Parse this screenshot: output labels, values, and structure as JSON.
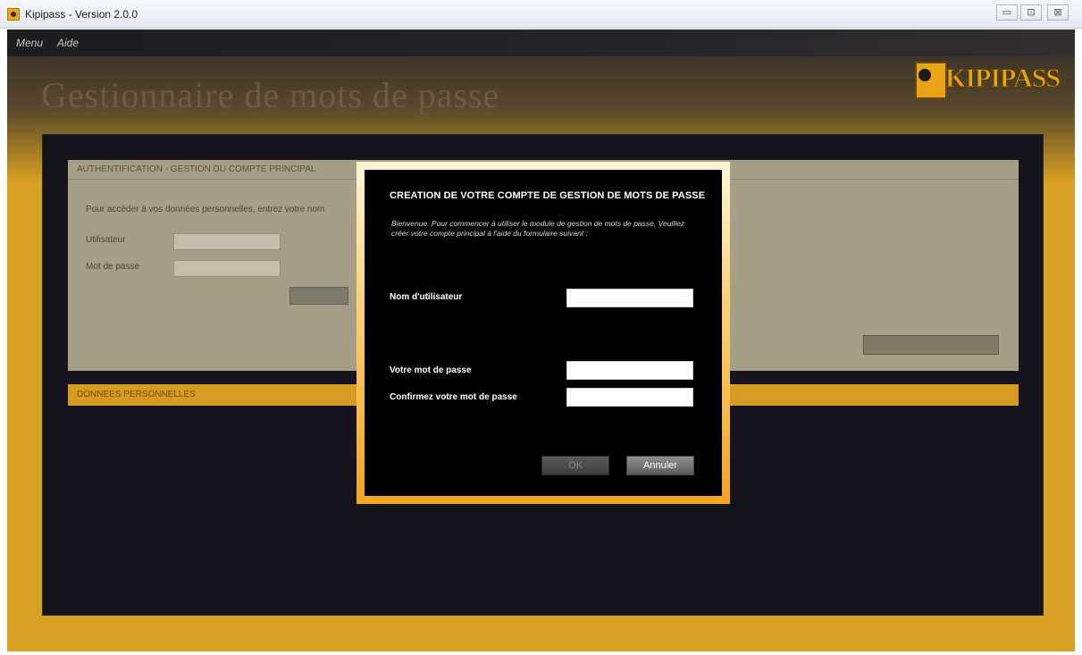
{
  "window": {
    "title": "Kipipass - Version 2.0.0",
    "controls": {
      "minimize": "▭",
      "maximize": "⊡",
      "close": "⊠"
    }
  },
  "menubar": {
    "items": [
      "Menu",
      "Aide"
    ]
  },
  "header": {
    "title": "Gestionnaire de mots de passe",
    "logo_text": "KIPIPASS"
  },
  "auth_section": {
    "header": "AUTHENTIFICATION - GESTION DU COMPTE PRINCIPAL",
    "intro": "Pour accéder à vos données personnelles, entrez votre nom",
    "username_label": "Utilisateur",
    "password_label": "Mot de passe",
    "login_button": "",
    "create_button": ""
  },
  "data_section": {
    "header": "DONNEES PERSONNELLES"
  },
  "footer": {
    "left": "",
    "right": ""
  },
  "dialog": {
    "title": "CREATION DE VOTRE COMPTE DE GESTION DE MOTS DE PASSE",
    "intro": "Bienvenue. Pour commencer à utiliser le module de gestion de mots de passe, Veuillez créer votre compte principal à l'aide du formulaire suivant :",
    "username_label": "Nom d'utilisateur",
    "username_value": "",
    "password_label": "Votre mot de passe",
    "password_value": "",
    "confirm_label": "Confirmez votre mot de passe",
    "confirm_value": "",
    "ok_button": "OK",
    "cancel_button": "Annuler"
  },
  "colors": {
    "accent": "#f5a322",
    "panel_bg": "#15141c",
    "dialog_bg": "#000000"
  }
}
